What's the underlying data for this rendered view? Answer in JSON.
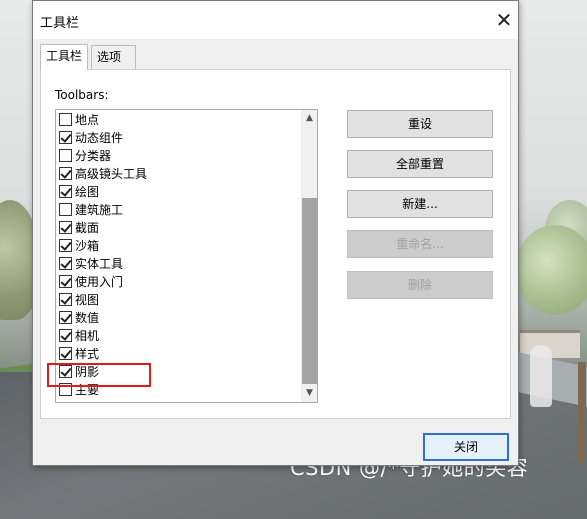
{
  "window": {
    "title": "工具栏",
    "close_glyph": "✕"
  },
  "tabs": [
    {
      "label": "工具栏",
      "active": true
    },
    {
      "label": "选项",
      "active": false
    }
  ],
  "toolbars_label": "Toolbars:",
  "toolbars": [
    {
      "label": "地点",
      "checked": false
    },
    {
      "label": "动态组件",
      "checked": true
    },
    {
      "label": "分类器",
      "checked": false
    },
    {
      "label": "高级镜头工具",
      "checked": true
    },
    {
      "label": "绘图",
      "checked": true
    },
    {
      "label": "建筑施工",
      "checked": false
    },
    {
      "label": "截面",
      "checked": true
    },
    {
      "label": "沙箱",
      "checked": true
    },
    {
      "label": "实体工具",
      "checked": true
    },
    {
      "label": "使用入门",
      "checked": true
    },
    {
      "label": "视图",
      "checked": true
    },
    {
      "label": "数值",
      "checked": true
    },
    {
      "label": "相机",
      "checked": true
    },
    {
      "label": "样式",
      "checked": true
    },
    {
      "label": "阴影",
      "checked": true
    },
    {
      "label": "主要",
      "checked": false
    }
  ],
  "buttons": {
    "reset": {
      "label": "重设",
      "enabled": true
    },
    "reset_all": {
      "label": "全部重置",
      "enabled": true
    },
    "new": {
      "label": "新建...",
      "enabled": true
    },
    "rename": {
      "label": "重命名...",
      "enabled": false
    },
    "delete": {
      "label": "删除",
      "enabled": false
    },
    "close": {
      "label": "关闭"
    }
  },
  "scrollbar": {
    "up_glyph": "▲",
    "down_glyph": "▼"
  },
  "watermark": "CSDN @/*守护她的笑容",
  "colors": {
    "highlight_box": "#e21a1a",
    "default_button_border": "#2e6fd1"
  }
}
